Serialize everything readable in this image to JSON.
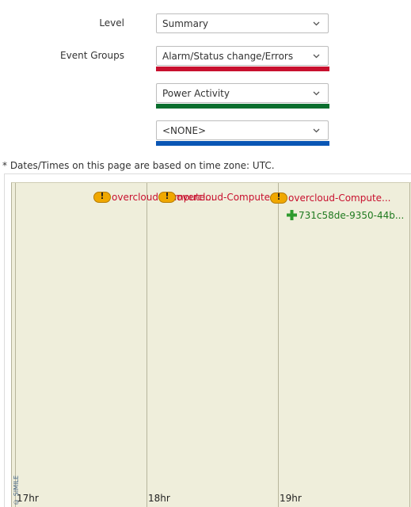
{
  "form": {
    "level_label": "Level",
    "level_value": "Summary",
    "event_groups_label": "Event Groups",
    "groups": [
      {
        "value": "Alarm/Status change/Errors",
        "color": "#c8102e"
      },
      {
        "value": "Power Activity",
        "color": "#0a6e2e"
      },
      {
        "value": "<NONE>",
        "color": "#0a56b4"
      }
    ]
  },
  "timezone_note": "* Dates/Times on this page are based on time zone: UTC.",
  "timeline": {
    "band_color": "#efeedb",
    "ticks": [
      "17hr",
      "18hr",
      "19hr"
    ],
    "events": [
      {
        "kind": "alarm",
        "label": "overcloud-Compute...",
        "color": "#c8102e"
      },
      {
        "kind": "alarm",
        "label": "overcloud-Compute...",
        "color": "#c8102e"
      },
      {
        "kind": "alarm",
        "label": "overcloud-Compute...",
        "color": "#c8102e"
      },
      {
        "kind": "power",
        "label": "731c58de-9350-44b...",
        "color": "#1f7a1f"
      }
    ],
    "copyright": "© SIMILE"
  }
}
